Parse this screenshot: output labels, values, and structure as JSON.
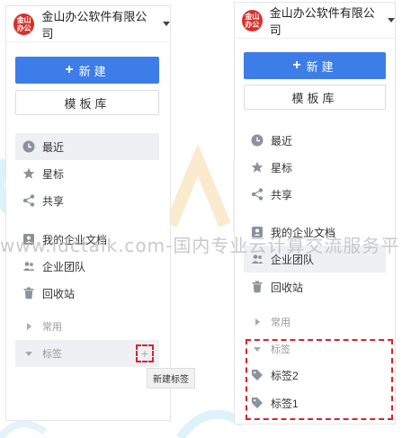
{
  "org_name": "金山办公软件有限公司",
  "logo_text": "金山办公",
  "new_button": "新建",
  "template_button": "模板库",
  "nav": {
    "recent": "最近",
    "star": "星标",
    "share": "共享",
    "my_docs": "我的企业文档",
    "team": "企业团队",
    "trash": "回收站",
    "common": "常用",
    "tags": "标签"
  },
  "tooltip": "新建标签",
  "tags": [
    "标签2",
    "标签1"
  ],
  "watermark": {
    "big": "TALK 云",
    "line": "www.idctalk.com-国内专业云计算交流服务平"
  },
  "colors": {
    "primary": "#3d7de8",
    "logo": "#d6322b",
    "highlight": "#d9232a",
    "icon": "#8a929c"
  }
}
